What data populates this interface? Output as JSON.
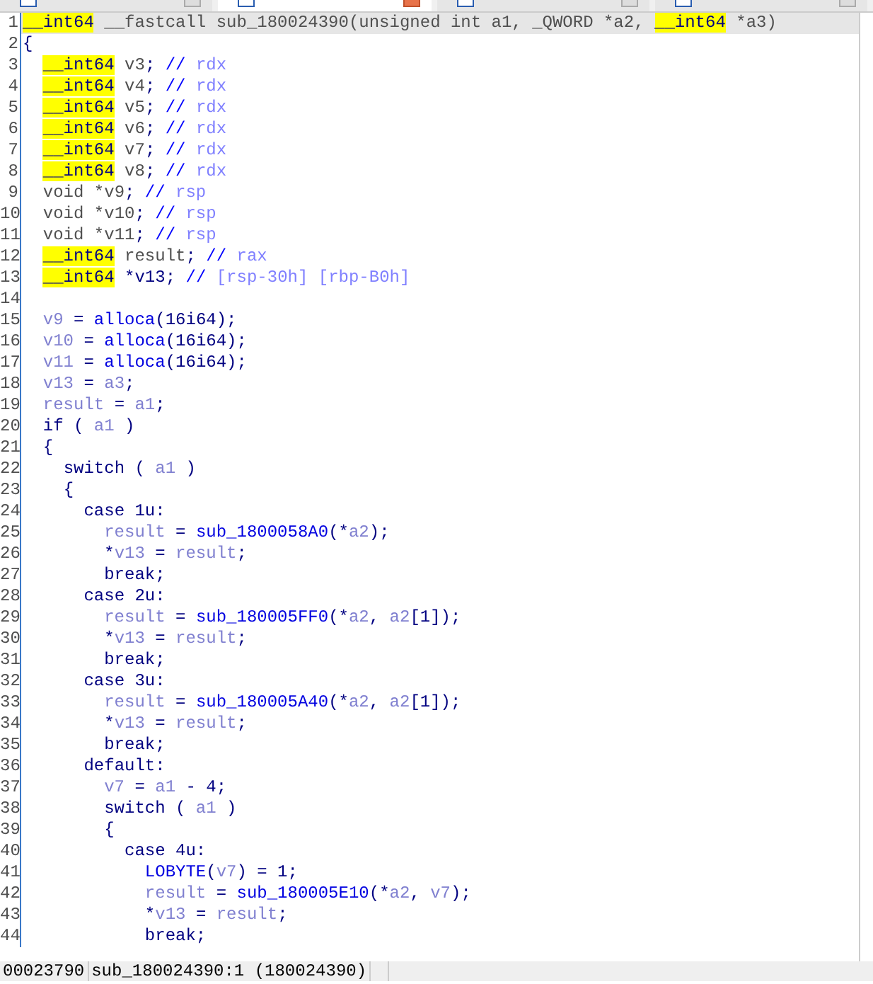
{
  "tabs": [
    {
      "selected": false
    },
    {
      "selected": true
    },
    {
      "selected": false
    },
    {
      "selected": false
    }
  ],
  "code": {
    "lines": [
      {
        "n": "1",
        "current": true,
        "tokens": [
          {
            "kind": "type",
            "text": "__int64"
          },
          {
            "kind": "g",
            "text": " __fastcall sub_180024390(unsigned int a1, _QWORD *a2, "
          },
          {
            "kind": "type",
            "text": "__int64"
          },
          {
            "kind": "g",
            "text": " *a3)"
          }
        ]
      },
      {
        "n": "2",
        "current": false,
        "tokens": [
          {
            "kind": "p",
            "text": "{"
          }
        ]
      },
      {
        "n": "3",
        "current": false,
        "tokens": [
          {
            "kind": "type",
            "text": "  __int64"
          },
          {
            "kind": "g",
            "text": " v3"
          },
          {
            "kind": "p",
            "text": "; "
          },
          {
            "kind": "cm",
            "text": "// "
          },
          {
            "kind": "reg",
            "text": "rdx"
          }
        ]
      },
      {
        "n": "4",
        "current": false,
        "tokens": [
          {
            "kind": "type",
            "text": "  __int64"
          },
          {
            "kind": "g",
            "text": " v4"
          },
          {
            "kind": "p",
            "text": "; "
          },
          {
            "kind": "cm",
            "text": "// "
          },
          {
            "kind": "reg",
            "text": "rdx"
          }
        ]
      },
      {
        "n": "5",
        "current": false,
        "tokens": [
          {
            "kind": "type",
            "text": "  __int64"
          },
          {
            "kind": "g",
            "text": " v5"
          },
          {
            "kind": "p",
            "text": "; "
          },
          {
            "kind": "cm",
            "text": "// "
          },
          {
            "kind": "reg",
            "text": "rdx"
          }
        ]
      },
      {
        "n": "6",
        "current": false,
        "tokens": [
          {
            "kind": "type",
            "text": "  __int64"
          },
          {
            "kind": "g",
            "text": " v6"
          },
          {
            "kind": "p",
            "text": "; "
          },
          {
            "kind": "cm",
            "text": "// "
          },
          {
            "kind": "reg",
            "text": "rdx"
          }
        ]
      },
      {
        "n": "7",
        "current": false,
        "tokens": [
          {
            "kind": "type",
            "text": "  __int64"
          },
          {
            "kind": "g",
            "text": " v7"
          },
          {
            "kind": "p",
            "text": "; "
          },
          {
            "kind": "cm",
            "text": "// "
          },
          {
            "kind": "reg",
            "text": "rdx"
          }
        ]
      },
      {
        "n": "8",
        "current": false,
        "tokens": [
          {
            "kind": "type",
            "text": "  __int64"
          },
          {
            "kind": "g",
            "text": " v8"
          },
          {
            "kind": "p",
            "text": "; "
          },
          {
            "kind": "cm",
            "text": "// "
          },
          {
            "kind": "reg",
            "text": "rdx"
          }
        ]
      },
      {
        "n": "9",
        "current": false,
        "tokens": [
          {
            "kind": "g",
            "text": "  void *v9"
          },
          {
            "kind": "p",
            "text": "; "
          },
          {
            "kind": "cm",
            "text": "// "
          },
          {
            "kind": "reg",
            "text": "rsp"
          }
        ]
      },
      {
        "n": "10",
        "current": false,
        "tokens": [
          {
            "kind": "g",
            "text": "  void *v10"
          },
          {
            "kind": "p",
            "text": "; "
          },
          {
            "kind": "cm",
            "text": "// "
          },
          {
            "kind": "reg",
            "text": "rsp"
          }
        ]
      },
      {
        "n": "11",
        "current": false,
        "tokens": [
          {
            "kind": "g",
            "text": "  void *v11"
          },
          {
            "kind": "p",
            "text": "; "
          },
          {
            "kind": "cm",
            "text": "// "
          },
          {
            "kind": "reg",
            "text": "rsp"
          }
        ]
      },
      {
        "n": "12",
        "current": false,
        "tokens": [
          {
            "kind": "type",
            "text": "  __int64"
          },
          {
            "kind": "g",
            "text": " result"
          },
          {
            "kind": "p",
            "text": "; "
          },
          {
            "kind": "cm",
            "text": "// "
          },
          {
            "kind": "reg",
            "text": "rax"
          }
        ]
      },
      {
        "n": "13",
        "current": false,
        "tokens": [
          {
            "kind": "type",
            "text": "  __int64"
          },
          {
            "kind": "p",
            "text": " *v13; "
          },
          {
            "kind": "cm",
            "text": "// "
          },
          {
            "kind": "reg",
            "text": "[rsp-30h] [rbp-B0h]"
          }
        ]
      },
      {
        "n": "14",
        "current": false
      },
      {
        "n": "15",
        "current": false,
        "tokens": [
          {
            "kind": "var",
            "text": "  v9"
          },
          {
            "kind": "p",
            "text": " = "
          },
          {
            "kind": "fn",
            "text": "alloca"
          },
          {
            "kind": "p",
            "text": "(16i64);"
          }
        ]
      },
      {
        "n": "16",
        "current": false,
        "tokens": [
          {
            "kind": "var",
            "text": "  v10"
          },
          {
            "kind": "p",
            "text": " = "
          },
          {
            "kind": "fn",
            "text": "alloca"
          },
          {
            "kind": "p",
            "text": "(16i64);"
          }
        ]
      },
      {
        "n": "17",
        "current": false,
        "tokens": [
          {
            "kind": "var",
            "text": "  v11"
          },
          {
            "kind": "p",
            "text": " = "
          },
          {
            "kind": "fn",
            "text": "alloca"
          },
          {
            "kind": "p",
            "text": "(16i64);"
          }
        ]
      },
      {
        "n": "18",
        "current": false,
        "tokens": [
          {
            "kind": "var",
            "text": "  v13"
          },
          {
            "kind": "p",
            "text": " = "
          },
          {
            "kind": "var",
            "text": "a3"
          },
          {
            "kind": "p",
            "text": ";"
          }
        ]
      },
      {
        "n": "19",
        "current": false,
        "tokens": [
          {
            "kind": "var",
            "text": "  result"
          },
          {
            "kind": "p",
            "text": " = "
          },
          {
            "kind": "var",
            "text": "a1"
          },
          {
            "kind": "p",
            "text": ";"
          }
        ]
      },
      {
        "n": "20",
        "current": false,
        "tokens": [
          {
            "kind": "p",
            "text": "  if ( "
          },
          {
            "kind": "var",
            "text": "a1"
          },
          {
            "kind": "p",
            "text": " )"
          }
        ]
      },
      {
        "n": "21",
        "current": false,
        "tokens": [
          {
            "kind": "p",
            "text": "  {"
          }
        ]
      },
      {
        "n": "22",
        "current": false,
        "tokens": [
          {
            "kind": "p",
            "text": "    switch ( "
          },
          {
            "kind": "var",
            "text": "a1"
          },
          {
            "kind": "p",
            "text": " )"
          }
        ]
      },
      {
        "n": "23",
        "current": false,
        "tokens": [
          {
            "kind": "p",
            "text": "    {"
          }
        ]
      },
      {
        "n": "24",
        "current": false,
        "tokens": [
          {
            "kind": "p",
            "text": "      case 1u:"
          }
        ]
      },
      {
        "n": "25",
        "current": false,
        "tokens": [
          {
            "kind": "var",
            "text": "        result"
          },
          {
            "kind": "p",
            "text": " = "
          },
          {
            "kind": "fn",
            "text": "sub_1800058A0"
          },
          {
            "kind": "p",
            "text": "(*"
          },
          {
            "kind": "var",
            "text": "a2"
          },
          {
            "kind": "p",
            "text": ");"
          }
        ]
      },
      {
        "n": "26",
        "current": false,
        "tokens": [
          {
            "kind": "p",
            "text": "        *"
          },
          {
            "kind": "var",
            "text": "v13"
          },
          {
            "kind": "p",
            "text": " = "
          },
          {
            "kind": "var",
            "text": "result"
          },
          {
            "kind": "p",
            "text": ";"
          }
        ]
      },
      {
        "n": "27",
        "current": false,
        "tokens": [
          {
            "kind": "p",
            "text": "        break;"
          }
        ]
      },
      {
        "n": "28",
        "current": false,
        "tokens": [
          {
            "kind": "p",
            "text": "      case 2u:"
          }
        ]
      },
      {
        "n": "29",
        "current": false,
        "tokens": [
          {
            "kind": "var",
            "text": "        result"
          },
          {
            "kind": "p",
            "text": " = "
          },
          {
            "kind": "fn",
            "text": "sub_180005FF0"
          },
          {
            "kind": "p",
            "text": "(*"
          },
          {
            "kind": "var",
            "text": "a2"
          },
          {
            "kind": "p",
            "text": ", "
          },
          {
            "kind": "var",
            "text": "a2"
          },
          {
            "kind": "p",
            "text": "[1]);"
          }
        ]
      },
      {
        "n": "30",
        "current": false,
        "tokens": [
          {
            "kind": "p",
            "text": "        *"
          },
          {
            "kind": "var",
            "text": "v13"
          },
          {
            "kind": "p",
            "text": " = "
          },
          {
            "kind": "var",
            "text": "result"
          },
          {
            "kind": "p",
            "text": ";"
          }
        ]
      },
      {
        "n": "31",
        "current": false,
        "tokens": [
          {
            "kind": "p",
            "text": "        break;"
          }
        ]
      },
      {
        "n": "32",
        "current": false,
        "tokens": [
          {
            "kind": "p",
            "text": "      case 3u:"
          }
        ]
      },
      {
        "n": "33",
        "current": false,
        "tokens": [
          {
            "kind": "var",
            "text": "        result"
          },
          {
            "kind": "p",
            "text": " = "
          },
          {
            "kind": "fn",
            "text": "sub_180005A40"
          },
          {
            "kind": "p",
            "text": "(*"
          },
          {
            "kind": "var",
            "text": "a2"
          },
          {
            "kind": "p",
            "text": ", "
          },
          {
            "kind": "var",
            "text": "a2"
          },
          {
            "kind": "p",
            "text": "[1]);"
          }
        ]
      },
      {
        "n": "34",
        "current": false,
        "tokens": [
          {
            "kind": "p",
            "text": "        *"
          },
          {
            "kind": "var",
            "text": "v13"
          },
          {
            "kind": "p",
            "text": " = "
          },
          {
            "kind": "var",
            "text": "result"
          },
          {
            "kind": "p",
            "text": ";"
          }
        ]
      },
      {
        "n": "35",
        "current": false,
        "tokens": [
          {
            "kind": "p",
            "text": "        break;"
          }
        ]
      },
      {
        "n": "36",
        "current": false,
        "tokens": [
          {
            "kind": "p",
            "text": "      default:"
          }
        ]
      },
      {
        "n": "37",
        "current": false,
        "tokens": [
          {
            "kind": "var",
            "text": "        v7"
          },
          {
            "kind": "p",
            "text": " = "
          },
          {
            "kind": "var",
            "text": "a1"
          },
          {
            "kind": "p",
            "text": " - 4;"
          }
        ]
      },
      {
        "n": "38",
        "current": false,
        "tokens": [
          {
            "kind": "p",
            "text": "        switch ( "
          },
          {
            "kind": "var",
            "text": "a1"
          },
          {
            "kind": "p",
            "text": " )"
          }
        ]
      },
      {
        "n": "39",
        "current": false,
        "tokens": [
          {
            "kind": "p",
            "text": "        {"
          }
        ]
      },
      {
        "n": "40",
        "current": false,
        "tokens": [
          {
            "kind": "p",
            "text": "          case 4u:"
          }
        ]
      },
      {
        "n": "41",
        "current": false,
        "tokens": [
          {
            "kind": "fn",
            "text": "            LOBYTE"
          },
          {
            "kind": "p",
            "text": "("
          },
          {
            "kind": "var",
            "text": "v7"
          },
          {
            "kind": "p",
            "text": ") = 1;"
          }
        ]
      },
      {
        "n": "42",
        "current": false,
        "tokens": [
          {
            "kind": "var",
            "text": "            result"
          },
          {
            "kind": "p",
            "text": " = "
          },
          {
            "kind": "fn",
            "text": "sub_180005E10"
          },
          {
            "kind": "p",
            "text": "(*"
          },
          {
            "kind": "var",
            "text": "a2"
          },
          {
            "kind": "p",
            "text": ", "
          },
          {
            "kind": "var",
            "text": "v7"
          },
          {
            "kind": "p",
            "text": ");"
          }
        ]
      },
      {
        "n": "43",
        "current": false,
        "tokens": [
          {
            "kind": "p",
            "text": "            *"
          },
          {
            "kind": "var",
            "text": "v13"
          },
          {
            "kind": "p",
            "text": " = "
          },
          {
            "kind": "var",
            "text": "result"
          },
          {
            "kind": "p",
            "text": ";"
          }
        ]
      },
      {
        "n": "44",
        "current": false,
        "tokens": [
          {
            "kind": "p",
            "text": "            break;"
          }
        ]
      }
    ]
  },
  "status_bar": {
    "address": "00023790",
    "location": "sub_180024390:1 (180024390)"
  }
}
